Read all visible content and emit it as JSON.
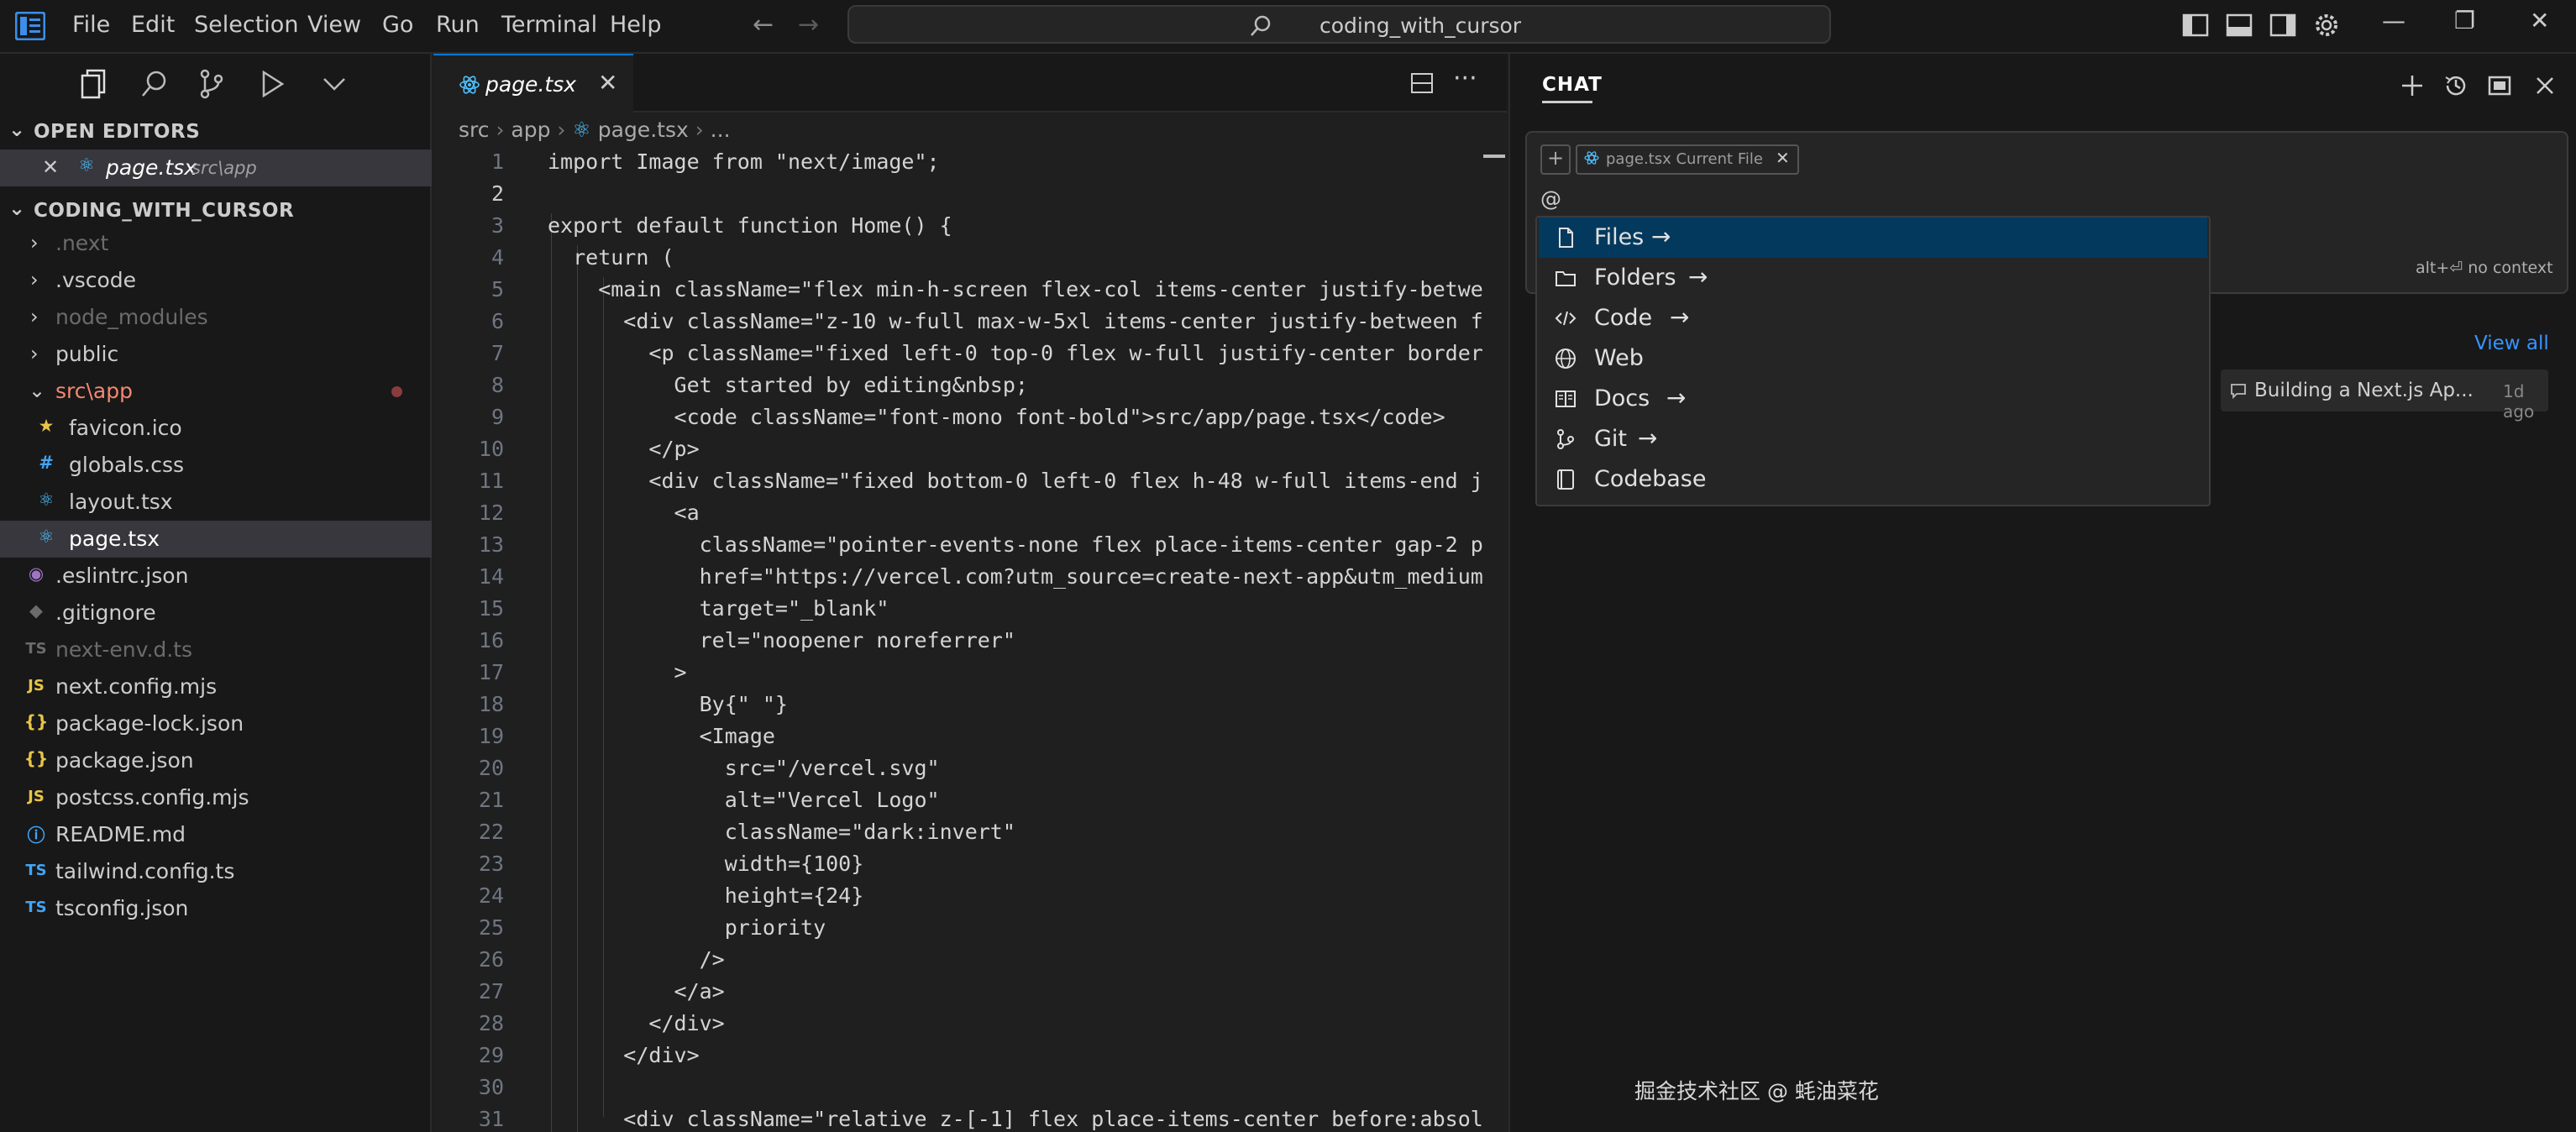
{
  "menu": [
    "File",
    "Edit",
    "Selection",
    "View",
    "Go",
    "Run",
    "Terminal",
    "Help"
  ],
  "command_center": {
    "title": "coding_with_cursor"
  },
  "sidebar": {
    "open_editors": {
      "header": "OPEN EDITORS",
      "items": [
        {
          "name": "page.tsx",
          "path": "src\\app"
        }
      ]
    },
    "project": {
      "header": "CODING_WITH_CURSOR",
      "items": [
        {
          "name": ".next",
          "kind": "folder"
        },
        {
          "name": ".vscode",
          "kind": "folder"
        },
        {
          "name": "node_modules",
          "kind": "folder"
        },
        {
          "name": "public",
          "kind": "folder"
        },
        {
          "name": "src\\app",
          "kind": "folder-open"
        },
        {
          "name": "favicon.ico",
          "icon": "★"
        },
        {
          "name": "globals.css",
          "icon": "#"
        },
        {
          "name": "layout.tsx",
          "icon": "⚛"
        },
        {
          "name": "page.tsx",
          "icon": "⚛"
        },
        {
          "name": ".eslintrc.json",
          "icon": "◉"
        },
        {
          "name": ".gitignore",
          "icon": "◆"
        },
        {
          "name": "next-env.d.ts",
          "icon": "TS"
        },
        {
          "name": "next.config.mjs",
          "icon": "JS"
        },
        {
          "name": "package-lock.json",
          "icon": "{}"
        },
        {
          "name": "package.json",
          "icon": "{}"
        },
        {
          "name": "postcss.config.mjs",
          "icon": "JS"
        },
        {
          "name": "README.md",
          "icon": "ⓘ"
        },
        {
          "name": "tailwind.config.ts",
          "icon": "TS"
        },
        {
          "name": "tsconfig.json",
          "icon": "TS"
        }
      ]
    }
  },
  "editor": {
    "tab_label": "page.tsx",
    "breadcrumb": [
      "src",
      "app",
      "page.tsx",
      "..."
    ],
    "lines": [
      {
        "n": "1",
        "t": "import Image from \"next/image\";"
      },
      {
        "n": "2",
        "t": ""
      },
      {
        "n": "3",
        "t": "export default function Home() {"
      },
      {
        "n": "4",
        "t": "  return ("
      },
      {
        "n": "5",
        "t": "    <main className=\"flex min-h-screen flex-col items-center justify-betwe"
      },
      {
        "n": "6",
        "t": "      <div className=\"z-10 w-full max-w-5xl items-center justify-between f"
      },
      {
        "n": "7",
        "t": "        <p className=\"fixed left-0 top-0 flex w-full justify-center border"
      },
      {
        "n": "8",
        "t": "          Get started by editing&nbsp;"
      },
      {
        "n": "9",
        "t": "          <code className=\"font-mono font-bold\">src/app/page.tsx</code>"
      },
      {
        "n": "10",
        "t": "        </p>"
      },
      {
        "n": "11",
        "t": "        <div className=\"fixed bottom-0 left-0 flex h-48 w-full items-end j"
      },
      {
        "n": "12",
        "t": "          <a"
      },
      {
        "n": "13",
        "t": "            className=\"pointer-events-none flex place-items-center gap-2 p"
      },
      {
        "n": "14",
        "t": "            href=\"https://vercel.com?utm_source=create-next-app&utm_medium"
      },
      {
        "n": "15",
        "t": "            target=\"_blank\""
      },
      {
        "n": "16",
        "t": "            rel=\"noopener noreferrer\""
      },
      {
        "n": "17",
        "t": "          >"
      },
      {
        "n": "18",
        "t": "            By{\" \"}"
      },
      {
        "n": "19",
        "t": "            <Image"
      },
      {
        "n": "20",
        "t": "              src=\"/vercel.svg\""
      },
      {
        "n": "21",
        "t": "              alt=\"Vercel Logo\""
      },
      {
        "n": "22",
        "t": "              className=\"dark:invert\""
      },
      {
        "n": "23",
        "t": "              width={100}"
      },
      {
        "n": "24",
        "t": "              height={24}"
      },
      {
        "n": "25",
        "t": "              priority"
      },
      {
        "n": "26",
        "t": "            />"
      },
      {
        "n": "27",
        "t": "          </a>"
      },
      {
        "n": "28",
        "t": "        </div>"
      },
      {
        "n": "29",
        "t": "      </div>"
      },
      {
        "n": "30",
        "t": ""
      },
      {
        "n": "31",
        "t": "      <div className=\"relative z-[-1] flex place-items-center before:absol"
      }
    ]
  },
  "chat": {
    "title": "CHAT",
    "context_chip": "page.tsx  Current File",
    "input_text": "@",
    "no_context_hint": "alt+⏎ no context",
    "mention_menu": [
      {
        "label": "Files",
        "icon": "file-icon",
        "arrow": true
      },
      {
        "label": "Folders",
        "icon": "folder-icon",
        "arrow": true
      },
      {
        "label": "Code",
        "icon": "code-icon",
        "arrow": true
      },
      {
        "label": "Web",
        "icon": "globe-icon",
        "arrow": false
      },
      {
        "label": "Docs",
        "icon": "docs-icon",
        "arrow": true
      },
      {
        "label": "Git",
        "icon": "git-icon",
        "arrow": true
      },
      {
        "label": "Codebase",
        "icon": "codebase-icon",
        "arrow": false
      }
    ],
    "view_all": "View all",
    "history": {
      "title": "Building a Next.js Ap...",
      "age": "1d ago"
    }
  },
  "watermark": "掘金技术社区 @ 蚝油菜花",
  "colors": {
    "accent": "#0078d4",
    "selection": "#04395e",
    "keyword": "#569cd6",
    "string": "#ce9178",
    "function": "#dcdcaa",
    "attr": "#c586c0"
  }
}
